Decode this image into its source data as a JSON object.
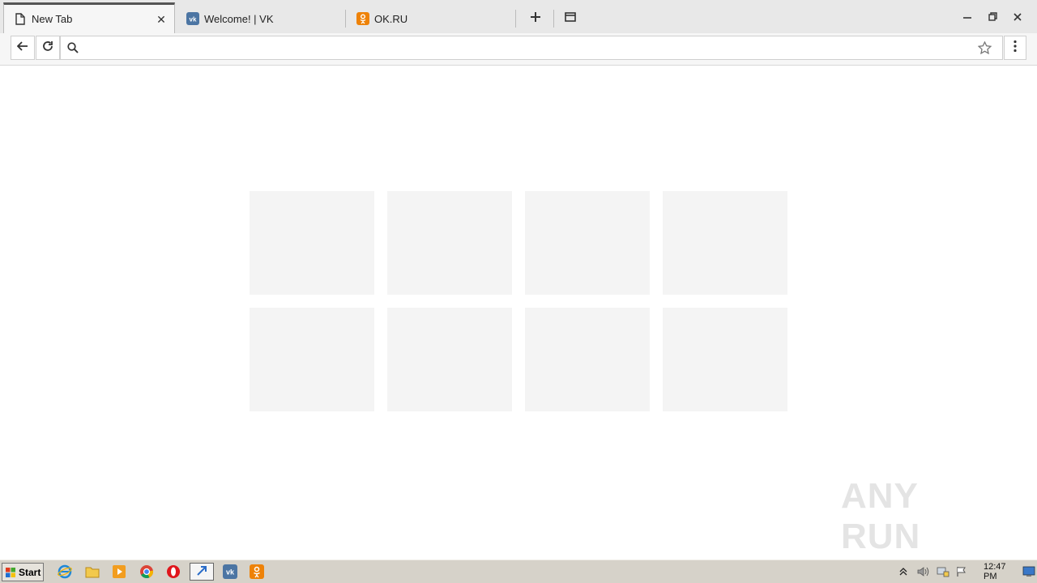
{
  "tabs": [
    {
      "title": "New Tab",
      "icon": "page-icon",
      "active": true
    },
    {
      "title": "Welcome! | VK",
      "icon": "vk-icon",
      "active": false
    },
    {
      "title": "OK.RU",
      "icon": "odnoklassniki-icon",
      "active": false
    }
  ],
  "omnibox": {
    "value": "",
    "placeholder": ""
  },
  "watermark": "ANY RUN",
  "taskbar": {
    "start_label": "Start",
    "clock": "12:47 PM"
  },
  "colors": {
    "vk_blue": "#4c75a3",
    "ok_orange": "#ee8208",
    "tile_bg": "#f4f4f4"
  }
}
